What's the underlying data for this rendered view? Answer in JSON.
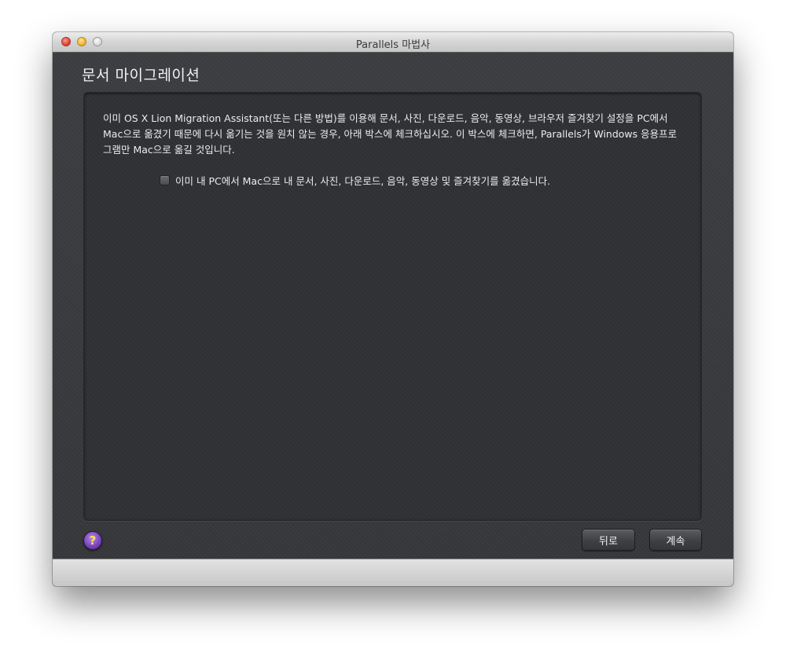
{
  "window": {
    "title": "Parallels 마법사"
  },
  "page": {
    "heading": "문서 마이그레이션",
    "description": "이미 OS X Lion Migration Assistant(또는 다른 방법)를 이용해 문서, 사진, 다운로드, 음악, 동영상, 브라우저 즐겨찾기 설정을 PC에서 Mac으로 옮겼기 때문에 다시 옮기는 것을 원치 않는 경우, 아래 박스에 체크하십시오. 이 박스에 체크하면, Parallels가 Windows 응용프로그램만 Mac으로 옮길 것입니다.",
    "checkbox": {
      "label": "이미 내 PC에서 Mac으로 내 문서, 사진, 다운로드, 음악, 동영상 및 즐겨찾기를 옮겼습니다.",
      "checked": false
    }
  },
  "footer": {
    "help_label": "?",
    "back_label": "뒤로",
    "continue_label": "계속"
  },
  "icons": {
    "help": "question-mark-icon",
    "checkbox": "checkbox-icon"
  },
  "colors": {
    "background": "#3a3b3f",
    "panel": "#303135",
    "text": "#ececec",
    "help_button": "#7a47bd",
    "help_glyph": "#ffe14d"
  }
}
